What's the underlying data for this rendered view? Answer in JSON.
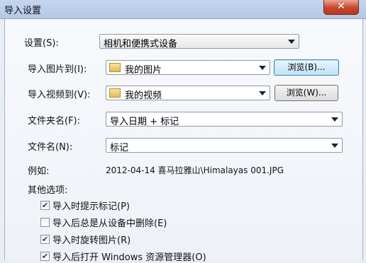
{
  "window": {
    "title": "导入设置",
    "close_glyph": "✕"
  },
  "settings": {
    "label": "设置(S):",
    "value": "相机和便携式设备"
  },
  "pictures": {
    "label": "导入图片到(I):",
    "value": "我的图片",
    "browse_label": "浏览(B)..."
  },
  "videos": {
    "label": "导入视频到(V):",
    "value": "我的视频",
    "browse_label": "浏览(W)..."
  },
  "folder_name": {
    "label": "文件夹名(F):",
    "value": "导入日期 + 标记"
  },
  "file_name": {
    "label": "文件名(N):",
    "value": "标记"
  },
  "example": {
    "label": "例如:",
    "value": "2012-04-14 喜马拉雅山\\Himalayas 001.JPG"
  },
  "other_options": {
    "label": "其他选项:",
    "items": [
      {
        "label": "导入时提示标记(P)",
        "checked": true
      },
      {
        "label": "导入后总是从设备中删除(E)",
        "checked": false
      },
      {
        "label": "导入时旋转图片(R)",
        "checked": true
      },
      {
        "label": "导入后打开 Windows 资源管理器(O)",
        "checked": true
      }
    ]
  },
  "colors": {
    "titlebar": "#b9cde9",
    "close_button": "#c9452a",
    "dialog_bg": "#f3f6fa",
    "focused_button": "#3c7fb1"
  },
  "icons": {
    "folder": "folder-icon",
    "dropdown": "chevron-down-icon",
    "check": "checkmark-icon"
  }
}
